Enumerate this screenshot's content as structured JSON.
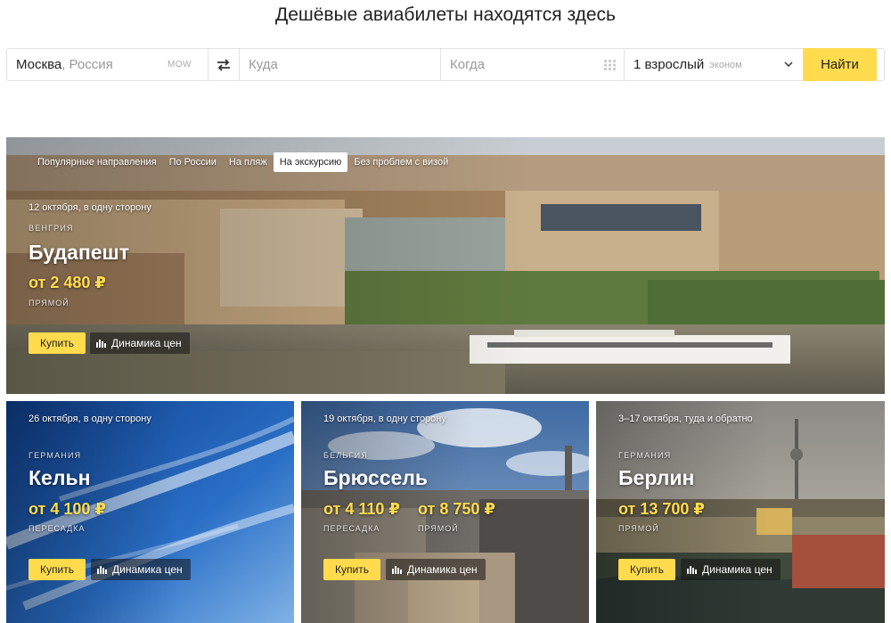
{
  "page": {
    "title": "Дешёвые авиабилеты находятся здесь"
  },
  "search": {
    "from_city": "Москва",
    "from_country": ", Россия",
    "from_code": "MOW",
    "to_placeholder": "Куда",
    "when_placeholder": "Когда",
    "passengers": "1 взрослый",
    "class": "эконом",
    "submit_label": "Найти"
  },
  "tabs": [
    {
      "label": "Популярные направления",
      "active": false
    },
    {
      "label": "По России",
      "active": false
    },
    {
      "label": "На пляж",
      "active": false
    },
    {
      "label": "На экскурсию",
      "active": true
    },
    {
      "label": "Без проблем с визой",
      "active": false
    }
  ],
  "common": {
    "buy_label": "Купить",
    "dynamics_label": "Динамика цен"
  },
  "cards": {
    "budapest": {
      "date": "12 октября, в одну сторону",
      "country": "ВЕНГРИЯ",
      "city": "Будапешт",
      "price": "от 2 480 ₽",
      "transfer": "ПРЯМОЙ"
    },
    "koln": {
      "date": "26 октября, в одну сторону",
      "country": "ГЕРМАНИЯ",
      "city": "Кельн",
      "price": "от 4 100 ₽",
      "transfer": "ПЕРЕСАДКА"
    },
    "brussels": {
      "date": "19 октября, в одну сторону",
      "country": "БЕЛЬГИЯ",
      "city": "Брюссель",
      "price": "от 4 110 ₽",
      "transfer": "ПЕРЕСАДКА",
      "price2": "от 8 750 ₽",
      "transfer2": "ПРЯМОЙ"
    },
    "berlin": {
      "date": "3–17 октября, туда и обратно",
      "country": "ГЕРМАНИЯ",
      "city": "Берлин",
      "price": "от 13 700 ₽",
      "transfer": "ПРЯМОЙ"
    }
  },
  "colors": {
    "accent": "#ffdb4d",
    "price": "#ffdb4d"
  }
}
